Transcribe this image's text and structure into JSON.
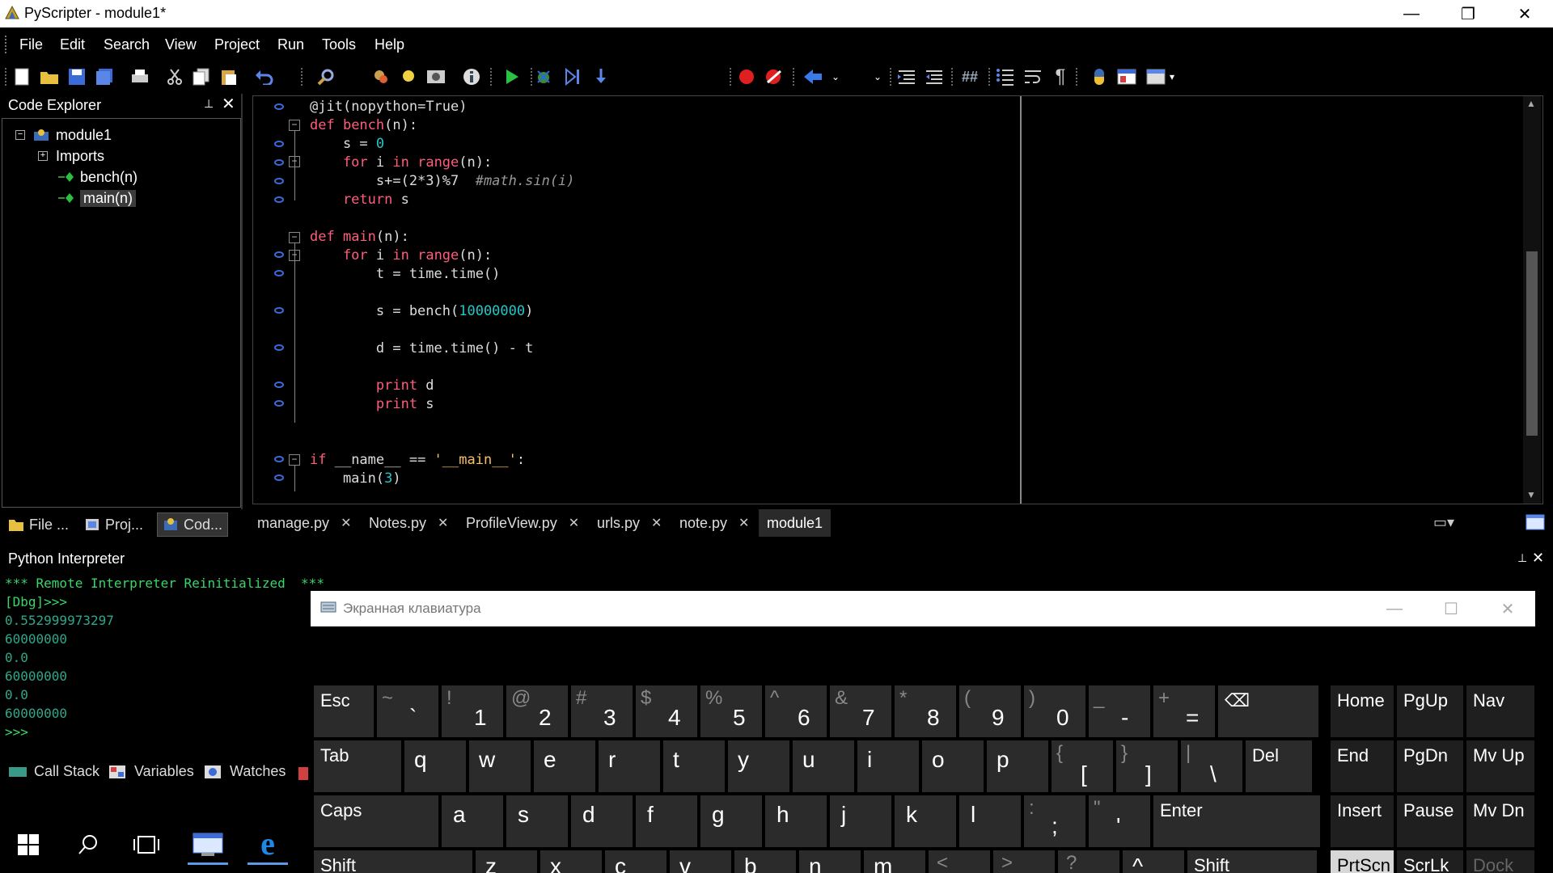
{
  "window": {
    "title": "PyScripter - module1*",
    "minimize": "—",
    "restore": "❐",
    "close": "✕"
  },
  "menu": [
    "File",
    "Edit",
    "Search",
    "View",
    "Project",
    "Run",
    "Tools",
    "Help"
  ],
  "code_explorer": {
    "title": "Code Explorer",
    "pin": "📌",
    "close": "✕",
    "tree": [
      {
        "label": "module1",
        "expander": "−"
      },
      {
        "label": "Imports",
        "expander": "+"
      },
      {
        "label": "bench(n)"
      },
      {
        "label": "main(n)"
      }
    ],
    "tabs": [
      "File ...",
      "Proj...",
      "Cod..."
    ]
  },
  "editor": {
    "lines": [
      {
        "parts": [
          [
            "deco",
            "@jit("
          ],
          [
            "deco",
            "nopython"
          ],
          [
            "deco",
            "=True)"
          ]
        ]
      },
      {
        "parts": [
          [
            "kw",
            "def "
          ],
          [
            "fn",
            "bench"
          ],
          [
            "deco",
            "(n):"
          ]
        ]
      },
      {
        "parts": [
          [
            "deco",
            "    s = "
          ],
          [
            "num",
            "0"
          ]
        ]
      },
      {
        "parts": [
          [
            "kw",
            "    for "
          ],
          [
            "deco",
            "i "
          ],
          [
            "kw",
            "in "
          ],
          [
            "kw",
            "range"
          ],
          [
            "deco",
            "(n):"
          ]
        ]
      },
      {
        "parts": [
          [
            "deco",
            "        s+=(2*3)%7  "
          ],
          [
            "cmt",
            "#math.sin(i)"
          ]
        ]
      },
      {
        "parts": [
          [
            "kw",
            "    return "
          ],
          [
            "deco",
            "s"
          ]
        ]
      },
      {
        "parts": [
          [
            "deco",
            ""
          ]
        ]
      },
      {
        "parts": [
          [
            "kw",
            "def "
          ],
          [
            "fn",
            "main"
          ],
          [
            "deco",
            "(n):"
          ]
        ]
      },
      {
        "parts": [
          [
            "kw",
            "    for "
          ],
          [
            "deco",
            "i "
          ],
          [
            "kw",
            "in "
          ],
          [
            "kw",
            "range"
          ],
          [
            "deco",
            "(n):"
          ]
        ]
      },
      {
        "parts": [
          [
            "deco",
            "        t = time.time()"
          ]
        ]
      },
      {
        "parts": [
          [
            "deco",
            ""
          ]
        ]
      },
      {
        "parts": [
          [
            "deco",
            "        s = bench("
          ],
          [
            "num",
            "10000000"
          ],
          [
            "deco",
            ")"
          ]
        ]
      },
      {
        "parts": [
          [
            "deco",
            ""
          ]
        ]
      },
      {
        "parts": [
          [
            "deco",
            "        d = time.time() - t"
          ]
        ]
      },
      {
        "parts": [
          [
            "deco",
            ""
          ]
        ]
      },
      {
        "parts": [
          [
            "kw",
            "        print "
          ],
          [
            "deco",
            "d"
          ]
        ]
      },
      {
        "parts": [
          [
            "kw",
            "        print "
          ],
          [
            "deco",
            "s"
          ]
        ]
      },
      {
        "parts": [
          [
            "deco",
            ""
          ]
        ]
      },
      {
        "parts": [
          [
            "deco",
            ""
          ]
        ]
      },
      {
        "parts": [
          [
            "kw",
            "if "
          ],
          [
            "deco",
            "__name__ == "
          ],
          [
            "str",
            "'__main__'"
          ],
          [
            "deco",
            ":"
          ]
        ]
      },
      {
        "parts": [
          [
            "deco",
            "    main("
          ],
          [
            "num",
            "3"
          ],
          [
            "deco",
            ")"
          ]
        ]
      }
    ],
    "tabs": [
      {
        "label": "manage.py",
        "close": "✕"
      },
      {
        "label": "Notes.py",
        "close": "✕"
      },
      {
        "label": "ProfileView.py",
        "close": "✕"
      },
      {
        "label": "urls.py",
        "close": "✕"
      },
      {
        "label": "note.py",
        "close": "✕"
      },
      {
        "label": "module1",
        "close": ""
      }
    ]
  },
  "interpreter": {
    "title": "Python Interpreter",
    "lines": [
      {
        "text": "*** Remote Interpreter Reinitialized  ***",
        "cls": "g1"
      },
      {
        "text": "[Dbg]>>>",
        "cls": "g1"
      },
      {
        "text": "0.552999973297",
        "cls": "g2"
      },
      {
        "text": "60000000",
        "cls": "g2"
      },
      {
        "text": "0.0",
        "cls": "g2"
      },
      {
        "text": "60000000",
        "cls": "g2"
      },
      {
        "text": "0.0",
        "cls": "g2"
      },
      {
        "text": "60000000",
        "cls": "g2"
      },
      {
        "text": ">>>",
        "cls": "g1"
      }
    ],
    "debug_tabs": [
      "Call Stack",
      "Variables",
      "Watches"
    ]
  },
  "osk": {
    "title": "Экранная клавиатура",
    "minimize": "—",
    "maximize": "☐",
    "close": "✕",
    "row1": [
      {
        "k": "Esc"
      },
      {
        "t": "~",
        "m": "`"
      },
      {
        "t": "!",
        "m": "1"
      },
      {
        "t": "@",
        "m": "2"
      },
      {
        "t": "#",
        "m": "3"
      },
      {
        "t": "$",
        "m": "4"
      },
      {
        "t": "%",
        "m": "5"
      },
      {
        "t": "^",
        "m": "6"
      },
      {
        "t": "&",
        "m": "7"
      },
      {
        "t": "*",
        "m": "8"
      },
      {
        "t": "(",
        "m": "9"
      },
      {
        "t": ")",
        "m": "0"
      },
      {
        "t": "_",
        "m": "-"
      },
      {
        "t": "+",
        "m": "="
      },
      {
        "k": "⌫"
      }
    ],
    "row2": [
      "Tab",
      "q",
      "w",
      "e",
      "r",
      "t",
      "y",
      "u",
      "i",
      "o",
      "p",
      "{",
      "}",
      "|",
      "Del"
    ],
    "row2_sub": {
      "{": "[",
      "}": "]",
      "|": "\\"
    },
    "row3": [
      "Caps",
      "a",
      "s",
      "d",
      "f",
      "g",
      "h",
      "j",
      "k",
      "l",
      ":",
      "\"",
      "Enter"
    ],
    "row3_sub": {
      ":": ";",
      "\"": "'"
    },
    "row4": [
      "Shift",
      "z",
      "x",
      "c",
      "v",
      "b",
      "n",
      "m",
      "<",
      ">",
      "?",
      "^",
      "Shift"
    ],
    "nav": [
      "Home",
      "PgUp",
      "Nav",
      "End",
      "PgDn",
      "Mv Up",
      "Insert",
      "Pause",
      "Mv Dn",
      "PrtScn",
      "ScrLk",
      "Dock"
    ]
  },
  "taskbar": {
    "items": [
      "windows-start",
      "search",
      "task-view",
      "pyscripter",
      "edge"
    ]
  },
  "colors": {
    "keyword": "#ff5d7a",
    "number": "#23c7c7",
    "string": "#f8c06a",
    "interp_green": "#38d66b",
    "breakpoint_marker": "#3a6ad8"
  }
}
